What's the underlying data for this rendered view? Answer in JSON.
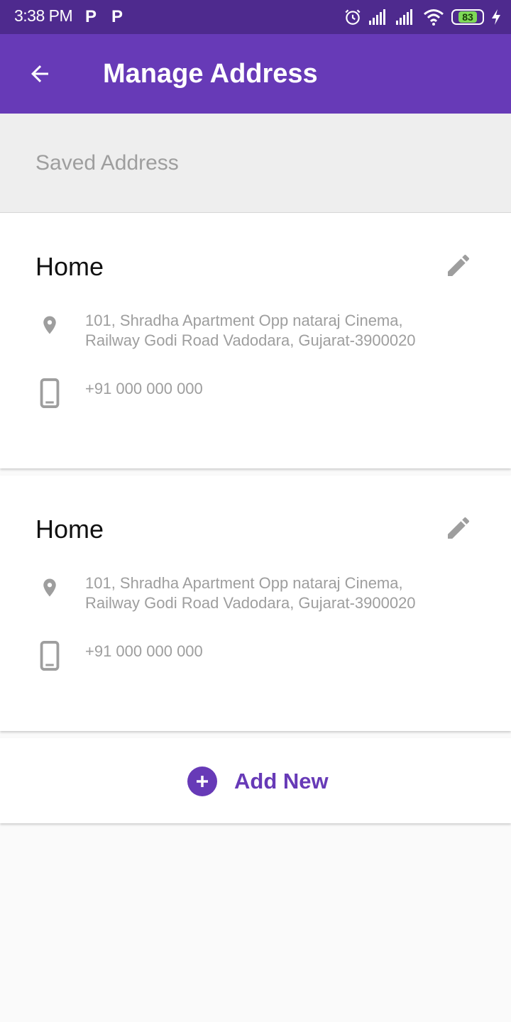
{
  "status_bar": {
    "time": "3:38 PM",
    "notif_1": "P",
    "notif_2": "P",
    "battery": "83",
    "icons": [
      "alarm-icon",
      "signal-icon",
      "signal-icon",
      "wifi-icon",
      "battery-icon",
      "charging-icon"
    ]
  },
  "app_bar": {
    "title": "Manage Address",
    "back_icon": "arrow-back-icon",
    "color": "#673ab7"
  },
  "section": {
    "title": "Saved Address"
  },
  "addresses": [
    {
      "name": "Home",
      "address_line1": "101, Shradha Apartment Opp nataraj Cinema,",
      "address_line2": "Railway Godi Road Vadodara, Gujarat-3900020",
      "phone": "+91 000 000 000",
      "edit_icon": "pencil-icon"
    },
    {
      "name": "Home",
      "address_line1": "101, Shradha Apartment Opp nataraj Cinema,",
      "address_line2": "Railway Godi Road Vadodara, Gujarat-3900020",
      "phone": "+91 000 000 000",
      "edit_icon": "pencil-icon"
    }
  ],
  "add_new": {
    "label": "Add New",
    "icon": "add-circle-icon"
  }
}
